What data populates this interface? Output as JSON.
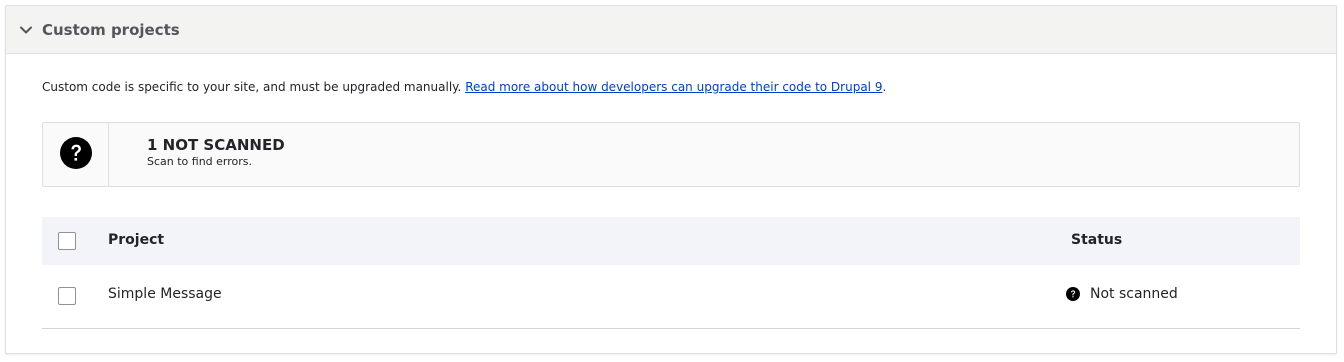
{
  "panel": {
    "title": "Custom projects",
    "expanded": true,
    "chevron_icon": "chevron-down-icon"
  },
  "description": {
    "text": "Custom code is specific to your site, and must be upgraded manually. ",
    "link_text": "Read more about how developers can upgrade their code to Drupal 9",
    "trailing": "."
  },
  "summary": {
    "icon": "question-circle-icon",
    "heading": "1 NOT SCANNED",
    "subtext": "Scan to find errors."
  },
  "table": {
    "columns": {
      "project": "Project",
      "status": "Status"
    },
    "rows": [
      {
        "project": "Simple Message",
        "status": "Not scanned",
        "status_icon": "question-circle-icon",
        "checked": false
      }
    ]
  },
  "colors": {
    "header_bg": "#f3f4f1",
    "table_header_bg": "#f3f4f9",
    "link": "#003ecc",
    "text": "#232429"
  }
}
